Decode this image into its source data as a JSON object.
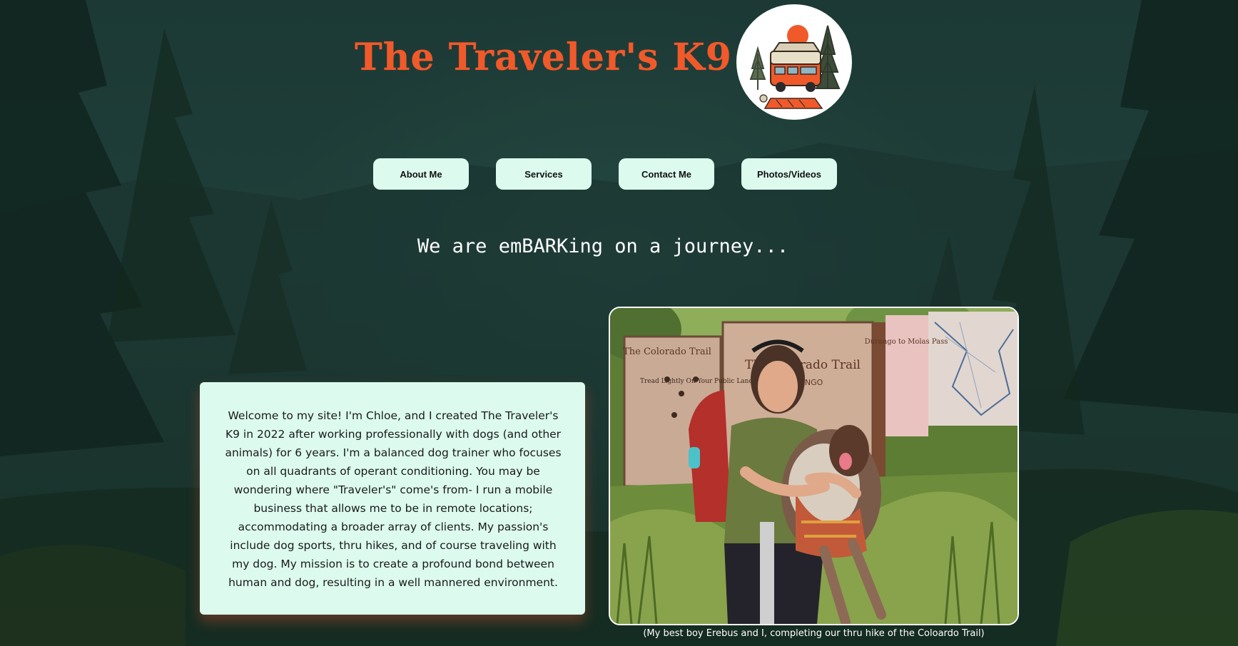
{
  "site": {
    "title": "The Traveler's K9"
  },
  "nav": {
    "items": [
      {
        "label": "About Me"
      },
      {
        "label": "Services"
      },
      {
        "label": "Contact Me"
      },
      {
        "label": "Photos/Videos"
      }
    ]
  },
  "hero": {
    "tagline": "We are emBARKing on a journey..."
  },
  "bio": {
    "text": "Welcome to my site! I'm Chloe, and I created The Traveler's K9 in 2022 after working professionally with dogs (and other animals) for 6 years. I'm a balanced dog trainer who focuses on all quadrants of operant conditioning. You may be wondering where \"Traveler's\" come's from- I run a mobile business that allows me to be in remote locations; accommodating a broader array of clients. My passion's include dog sports, thru hikes, and of course traveling with my dog. My mission is to create a profound bond between human and dog, resulting in a well mannered environment."
  },
  "photo": {
    "caption": "(My best boy Erebus and I, completing our thru hike of the Coloardo Trail)",
    "sign_text_1": "The Colorado Trail",
    "sign_text_2": "DURANGO",
    "sign_text_3": "Durango to Molas Pass",
    "sign_text_4": "Tread Lightly On Your Public Lands"
  },
  "colors": {
    "title": "#f05a2b",
    "button_bg": "#dcfbee",
    "card_bg": "#dcfbee",
    "background": "#1f3a36"
  }
}
